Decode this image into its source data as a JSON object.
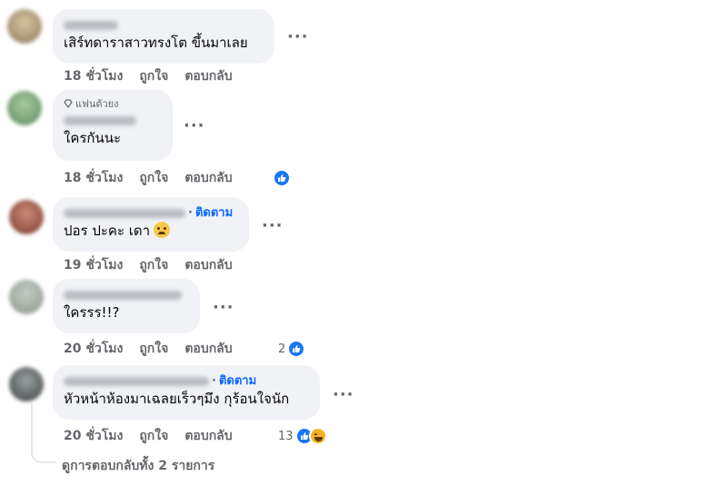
{
  "labels": {
    "like": "ถูกใจ",
    "reply": "ตอบกลับ",
    "follow": "ติดตาม",
    "more": "···",
    "dot": "·"
  },
  "comments": [
    {
      "time": "18 ชั่วโมง",
      "text": "เสิร์ทดาราสาวทรงโต ขึ้นมาเลย"
    },
    {
      "time": "18 ชั่วโมง",
      "text": "ใครกันนะ",
      "badge": "แฟนตัวยง"
    },
    {
      "time": "19 ชั่วโมง",
      "text": "ปอร ปะคะ เดา"
    },
    {
      "time": "20 ชั่วโมง",
      "text": "ใครรร!!?",
      "reaction_count": "2"
    },
    {
      "time": "20 ชั่วโมง",
      "text": "หัวหน้าห้องมาเฉลยเร็วๆมึง กุร้อนใจนัก",
      "reaction_count": "13"
    }
  ],
  "view_replies": "ดูการตอบกลับทั้ง 2 รายการ",
  "colors": {
    "accent": "#0866ff",
    "bubble": "#f0f2f5",
    "meta": "#65676b",
    "like": "#1877f2"
  }
}
